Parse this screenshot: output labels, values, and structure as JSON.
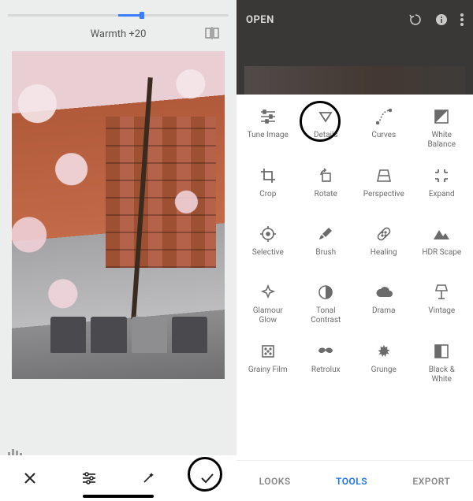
{
  "editor": {
    "adjustment_label": "Warmth +20",
    "slider": {
      "min": -100,
      "max": 100,
      "value": 20,
      "center": 0
    }
  },
  "editor_buttons": {
    "cancel": "Cancel",
    "tune": "Adjust",
    "wand": "Auto",
    "accept": "Accept"
  },
  "right_header": {
    "open_label": "OPEN"
  },
  "tools": [
    {
      "id": "tune-image",
      "label": "Tune Image",
      "icon": "sliders"
    },
    {
      "id": "details",
      "label": "Details",
      "icon": "triangle-down"
    },
    {
      "id": "curves",
      "label": "Curves",
      "icon": "curve"
    },
    {
      "id": "white-balance",
      "label": "White\nBalance",
      "icon": "wb"
    },
    {
      "id": "crop",
      "label": "Crop",
      "icon": "crop"
    },
    {
      "id": "rotate",
      "label": "Rotate",
      "icon": "rotate"
    },
    {
      "id": "perspective",
      "label": "Perspective",
      "icon": "perspective"
    },
    {
      "id": "expand",
      "label": "Expand",
      "icon": "expand"
    },
    {
      "id": "selective",
      "label": "Selective",
      "icon": "target"
    },
    {
      "id": "brush",
      "label": "Brush",
      "icon": "brush"
    },
    {
      "id": "healing",
      "label": "Healing",
      "icon": "bandaid"
    },
    {
      "id": "hdr-scape",
      "label": "HDR Scape",
      "icon": "mountain"
    },
    {
      "id": "glamour-glow",
      "label": "Glamour\nGlow",
      "icon": "sparkle"
    },
    {
      "id": "tonal-contrast",
      "label": "Tonal\nContrast",
      "icon": "contrast"
    },
    {
      "id": "drama",
      "label": "Drama",
      "icon": "cloud"
    },
    {
      "id": "vintage",
      "label": "Vintage",
      "icon": "lamp"
    },
    {
      "id": "grainy-film",
      "label": "Grainy Film",
      "icon": "film"
    },
    {
      "id": "retrolux",
      "label": "Retrolux",
      "icon": "mustache"
    },
    {
      "id": "grunge",
      "label": "Grunge",
      "icon": "splat"
    },
    {
      "id": "black-white",
      "label": "Black &\nWhite",
      "icon": "bw"
    }
  ],
  "tabs": {
    "looks": "LOOKS",
    "tools": "TOOLS",
    "export": "EXPORT",
    "active": "tools"
  },
  "annotations": {
    "highlight_tool": "details",
    "highlight_accept": true
  }
}
